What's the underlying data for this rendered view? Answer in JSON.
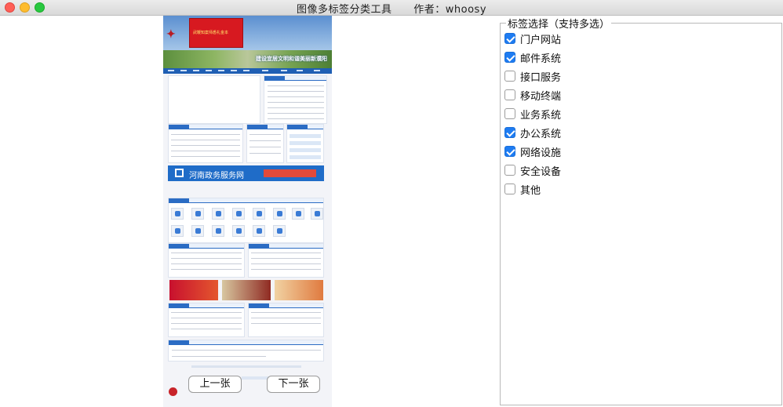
{
  "window": {
    "title": "图像多标签分类工具      作者：whoosy"
  },
  "preview": {
    "banner_text": "武鞭知案师悉礼金本",
    "slogan": "建设宜居文明和谐美丽新濮阳",
    "gov_banner_text": "河南政务服务网"
  },
  "navigation": {
    "prev_label": "上一张",
    "next_label": "下一张"
  },
  "tag_panel": {
    "legend": "标签选择（支持多选）",
    "options": [
      {
        "label": "门户网站",
        "checked": true
      },
      {
        "label": "邮件系统",
        "checked": true
      },
      {
        "label": "接口服务",
        "checked": false
      },
      {
        "label": "移动终端",
        "checked": false
      },
      {
        "label": "业务系统",
        "checked": false
      },
      {
        "label": "办公系统",
        "checked": true
      },
      {
        "label": "网络设施",
        "checked": true
      },
      {
        "label": "安全设备",
        "checked": false
      },
      {
        "label": "其他",
        "checked": false
      }
    ]
  },
  "colors": {
    "checkbox_checked": "#1e7cf2",
    "site_blue": "#1f6cc8"
  }
}
